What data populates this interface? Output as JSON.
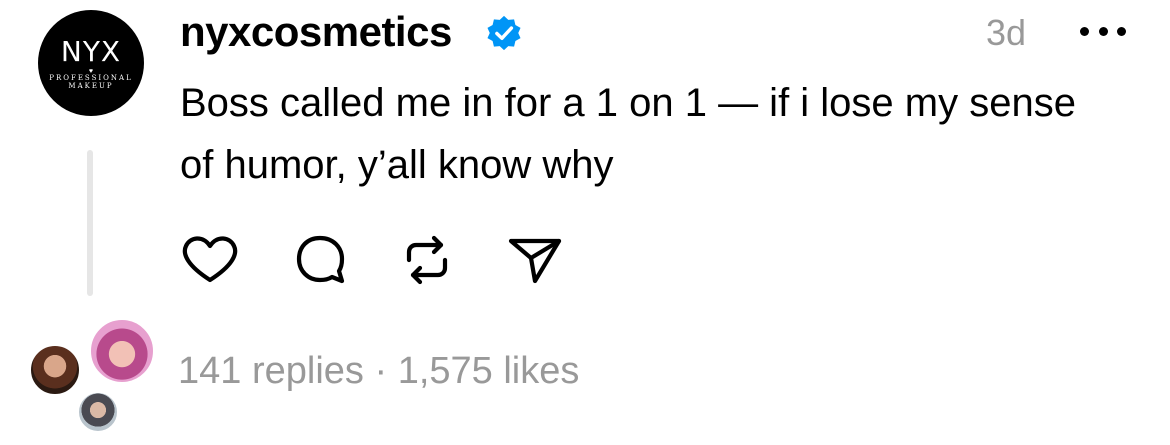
{
  "post": {
    "avatar": {
      "logo_text": "NYX",
      "logo_subtext_1": "PROFESSIONAL",
      "logo_subtext_2": "MAKEUP"
    },
    "username": "nyxcosmetics",
    "verified": true,
    "timestamp": "3d",
    "text": "Boss called me in for a 1 on 1 — if i lose my sense of humor, y’all know why",
    "actions": [
      {
        "name": "like",
        "icon": "heart-icon"
      },
      {
        "name": "reply",
        "icon": "comment-icon"
      },
      {
        "name": "repost",
        "icon": "repost-icon"
      },
      {
        "name": "share",
        "icon": "send-icon"
      }
    ],
    "stats": {
      "replies": "141 replies",
      "separator": " · ",
      "likes": "1,575 likes"
    }
  },
  "colors": {
    "text": "#000000",
    "muted": "#999999",
    "verified_badge": "#0095f6",
    "thread_line": "#e6e6e6"
  }
}
